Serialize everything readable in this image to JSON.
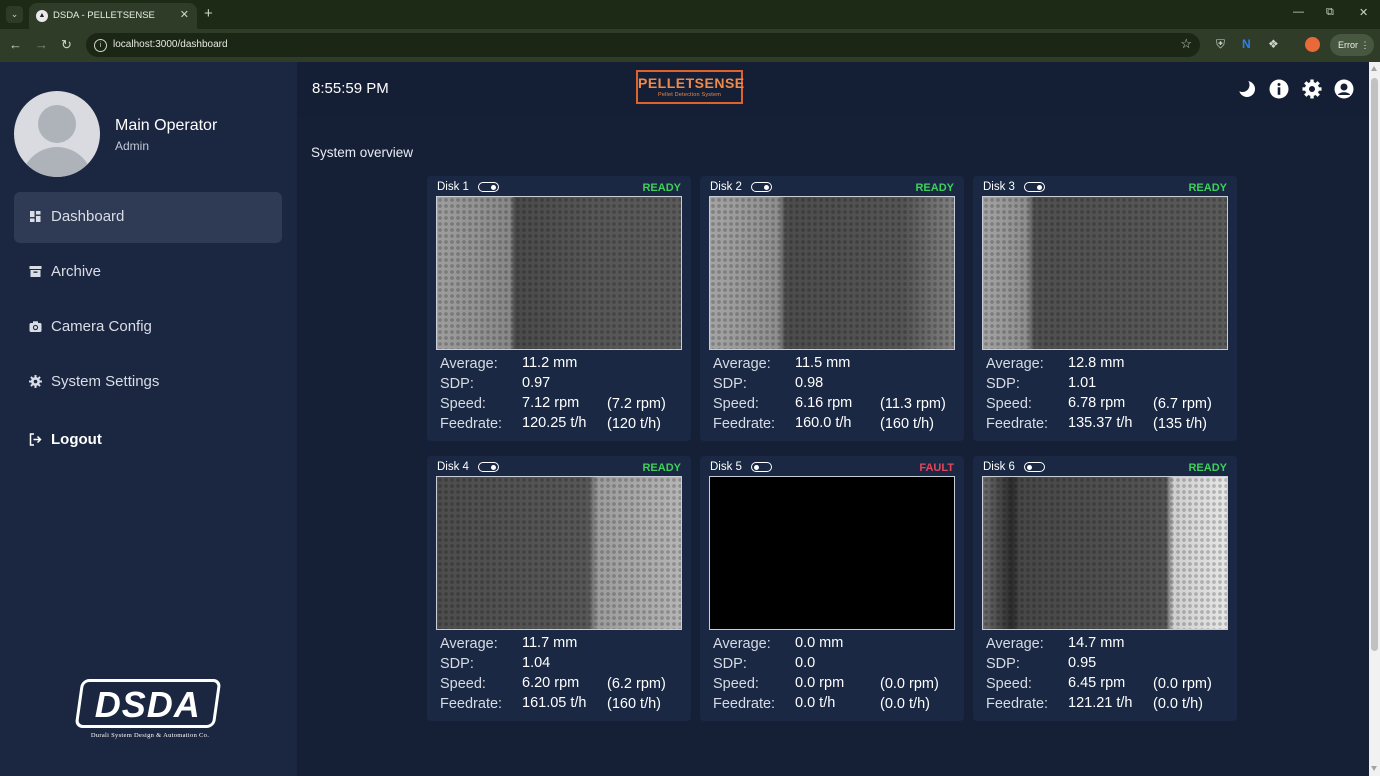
{
  "browser": {
    "tab_title": "DSDA - PELLETSENSE",
    "url": "localhost:3000/dashboard",
    "error_label": "Error"
  },
  "user": {
    "name": "Main Operator",
    "role": "Admin"
  },
  "nav": [
    {
      "label": "Dashboard",
      "icon": "dashboard-grid-icon",
      "active": true
    },
    {
      "label": "Archive",
      "icon": "archive-box-icon"
    },
    {
      "label": "Camera Config",
      "icon": "camera-icon"
    },
    {
      "label": "System Settings",
      "icon": "gear-icon"
    },
    {
      "label": "Logout",
      "icon": "logout-icon"
    }
  ],
  "company_logo": {
    "text": "DSDA",
    "tagline": "Durali System Design & Automation Co."
  },
  "header": {
    "time": "8:55:59 PM",
    "brand_name": "PELLETSENSE",
    "brand_tagline": "Pellet Detection System"
  },
  "section_title": "System overview",
  "labels": {
    "average": "Average:",
    "sdp": "SDP:",
    "speed": "Speed:",
    "feedrate": "Feedrate:"
  },
  "colors": {
    "ready": "#3fcf5c",
    "fault": "#e0475d",
    "accent": "#e0622b"
  },
  "disks": [
    {
      "name": "Disk 1",
      "enabled": true,
      "status": "READY",
      "average": "11.2 mm",
      "sdp": "0.97",
      "speed": "7.12 rpm",
      "speed_set": "(7.2 rpm)",
      "feedrate": "120.25 t/h",
      "feedrate_set": "(120 t/h)"
    },
    {
      "name": "Disk 2",
      "enabled": true,
      "status": "READY",
      "average": "11.5 mm",
      "sdp": "0.98",
      "speed": "6.16 rpm",
      "speed_set": "(11.3 rpm)",
      "feedrate": "160.0 t/h",
      "feedrate_set": "(160 t/h)"
    },
    {
      "name": "Disk 3",
      "enabled": true,
      "status": "READY",
      "average": "12.8 mm",
      "sdp": "1.01",
      "speed": "6.78 rpm",
      "speed_set": "(6.7 rpm)",
      "feedrate": "135.37 t/h",
      "feedrate_set": "(135 t/h)"
    },
    {
      "name": "Disk 4",
      "enabled": true,
      "status": "READY",
      "average": "11.7 mm",
      "sdp": "1.04",
      "speed": "6.20 rpm",
      "speed_set": "(6.2 rpm)",
      "feedrate": "161.05 t/h",
      "feedrate_set": "(160 t/h)"
    },
    {
      "name": "Disk 5",
      "enabled": false,
      "status": "FAULT",
      "average": "0.0 mm",
      "sdp": "0.0",
      "speed": "0.0 rpm",
      "speed_set": "(0.0 rpm)",
      "feedrate": "0.0 t/h",
      "feedrate_set": "(0.0 t/h)"
    },
    {
      "name": "Disk 6",
      "enabled": false,
      "status": "READY",
      "average": "14.7 mm",
      "sdp": "0.95",
      "speed": "6.45 rpm",
      "speed_set": "(0.0 rpm)",
      "feedrate": "121.21 t/h",
      "feedrate_set": "(0.0 t/h)"
    }
  ]
}
